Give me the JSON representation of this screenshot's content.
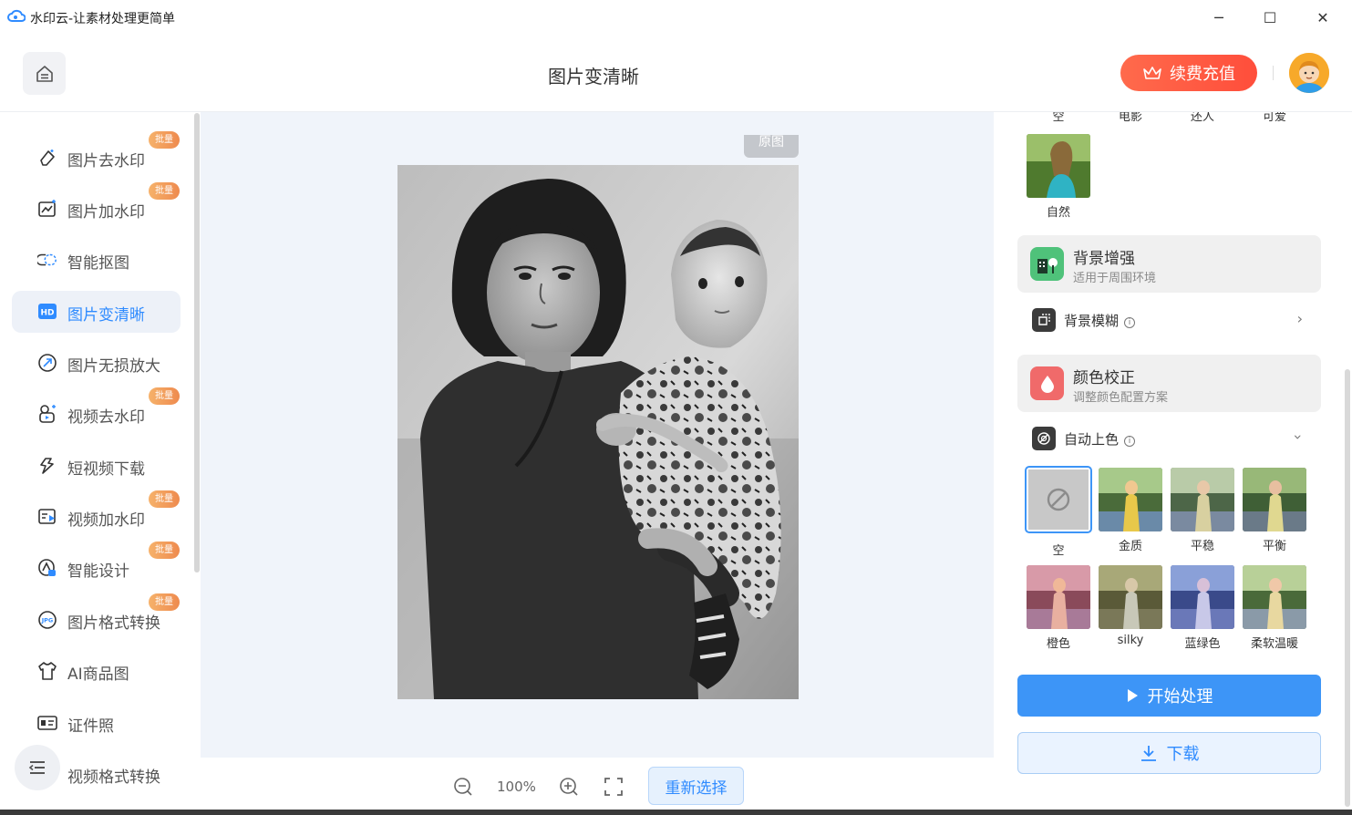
{
  "window": {
    "title": "水印云-让素材处理更简单",
    "controls": {
      "minimize": "─",
      "maximize": "☐",
      "close": "✕"
    }
  },
  "header": {
    "page_title": "图片变清晰",
    "vip_label": "续费充值"
  },
  "sidebar": {
    "items": [
      {
        "label": "图片去水印",
        "badge": "批量",
        "icon": "eraser-icon"
      },
      {
        "label": "图片加水印",
        "badge": "批量",
        "icon": "image-chart-icon"
      },
      {
        "label": "智能抠图",
        "badge": "",
        "icon": "cutout-icon"
      },
      {
        "label": "图片变清晰",
        "badge": "",
        "icon": "hd-icon",
        "active": true
      },
      {
        "label": "图片无损放大",
        "badge": "",
        "icon": "enlarge-icon"
      },
      {
        "label": "视频去水印",
        "badge": "批量",
        "icon": "video-eraser-icon"
      },
      {
        "label": "短视频下载",
        "badge": "",
        "icon": "link-icon"
      },
      {
        "label": "视频加水印",
        "badge": "批量",
        "icon": "video-play-icon"
      },
      {
        "label": "智能设计",
        "badge": "批量",
        "icon": "design-icon"
      },
      {
        "label": "图片格式转换",
        "badge": "批量",
        "icon": "jpg-icon"
      },
      {
        "label": "AI商品图",
        "badge": "",
        "icon": "shirt-icon"
      },
      {
        "label": "证件照",
        "badge": "",
        "icon": "id-card-icon"
      },
      {
        "label": "视频格式转换",
        "badge": "",
        "icon": "video-convert-icon"
      }
    ]
  },
  "canvas": {
    "original_tag": "原图",
    "zoom": "100%",
    "reselect_label": "重新选择"
  },
  "right_panel": {
    "cut_labels": [
      "空",
      "电影",
      "还人",
      "可爱"
    ],
    "style_presets": [
      {
        "label": "自然"
      }
    ],
    "background_section": {
      "title": "背景增强",
      "subtitle": "适用于周围环境"
    },
    "blur_option": {
      "label": "背景模糊"
    },
    "color_section": {
      "title": "颜色校正",
      "subtitle": "调整颜色配置方案"
    },
    "colorize_option": {
      "label": "自动上色"
    },
    "color_presets": [
      "空",
      "金质",
      "平稳",
      "平衡",
      "橙色",
      "silky",
      "蓝绿色",
      "柔软温暖"
    ],
    "start_label": "开始处理",
    "download_label": "下载"
  },
  "colors": {
    "accent": "#3d95f7",
    "vip": "#ff5a44",
    "badge": "#ee8a4e"
  }
}
